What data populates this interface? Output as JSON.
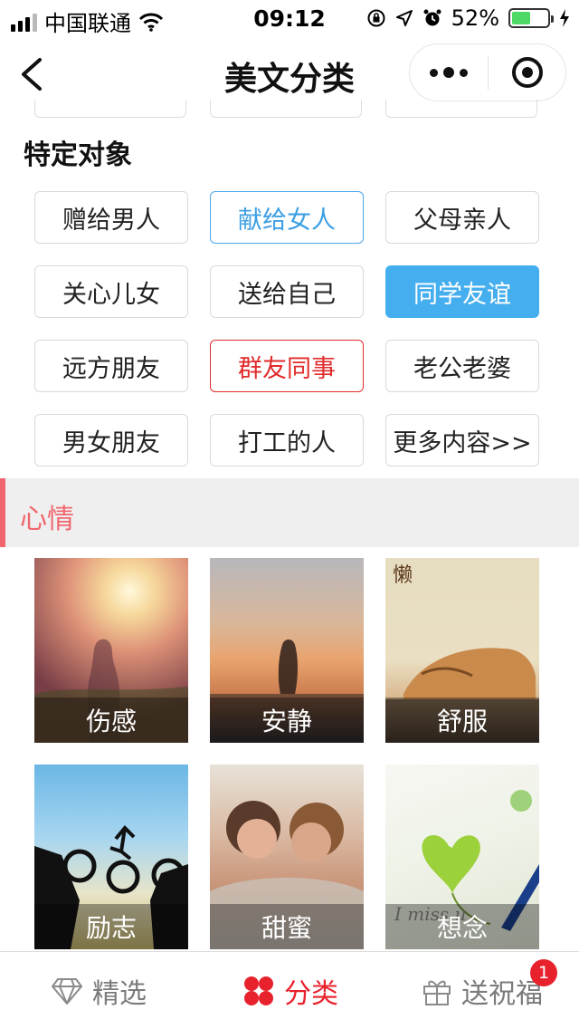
{
  "status_bar": {
    "carrier": "中国联通",
    "time": "09:12",
    "battery_percent": "52%",
    "battery_level": 0.52,
    "battery_color": "#4cd964"
  },
  "nav": {
    "title": "美文分类",
    "back_icon": "chevron-left-icon",
    "more_icon": "more-dots-icon",
    "close_icon": "target-circle-icon"
  },
  "section": {
    "title": "特定对象",
    "tags": [
      {
        "label": "赠给男人",
        "style": "default"
      },
      {
        "label": "献给女人",
        "style": "outline-blue"
      },
      {
        "label": "父母亲人",
        "style": "default"
      },
      {
        "label": "关心儿女",
        "style": "default"
      },
      {
        "label": "送给自己",
        "style": "default"
      },
      {
        "label": "同学友谊",
        "style": "solid-blue"
      },
      {
        "label": "远方朋友",
        "style": "default"
      },
      {
        "label": "群友同事",
        "style": "outline-red"
      },
      {
        "label": "老公老婆",
        "style": "default"
      },
      {
        "label": "男女朋友",
        "style": "default"
      },
      {
        "label": "打工的人",
        "style": "default"
      },
      {
        "label": "更多内容>>",
        "style": "default"
      }
    ]
  },
  "mood": {
    "title": "心情",
    "accent_color": "#f0666e",
    "cards": [
      {
        "label": "伤感"
      },
      {
        "label": "安静"
      },
      {
        "label": "舒服"
      },
      {
        "label": "励志"
      },
      {
        "label": "甜蜜"
      },
      {
        "label": "想念"
      }
    ]
  },
  "tabbar": {
    "tabs": [
      {
        "label": "精选",
        "icon": "diamond-icon"
      },
      {
        "label": "分类",
        "icon": "four-petal-icon",
        "active": true
      },
      {
        "label": "送祝福",
        "icon": "gift-icon"
      }
    ],
    "badge": "1",
    "active_color": "#e8222d"
  }
}
